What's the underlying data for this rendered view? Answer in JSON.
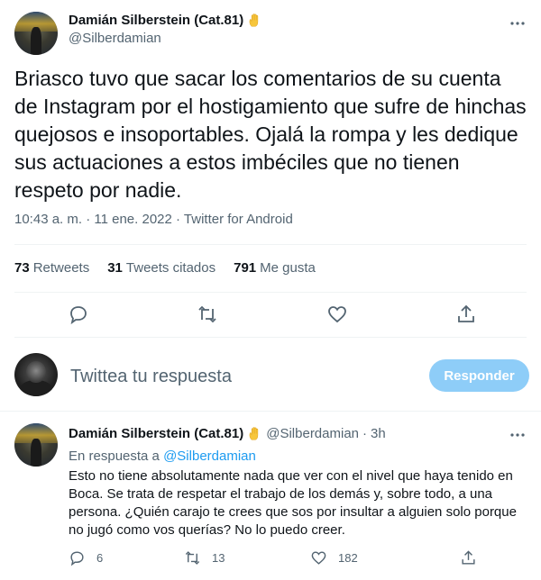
{
  "main_tweet": {
    "author_name": "Damián Silberstein (Cat.81)",
    "author_handle": "@Silberdamian",
    "text": "Briasco tuvo que sacar los comentarios de su cuenta de Instagram por el hostigamiento que sufre de hinchas quejosos e insoportables. Ojalá la rompa y les dedique sus actuaciones a estos imbéciles que no tienen respeto por nadie.",
    "meta": "10:43 a. m. · 11 ene. 2022 · Twitter for Android",
    "stats": {
      "retweets_count": "73",
      "retweets_label": "Retweets",
      "quotes_count": "31",
      "quotes_label": "Tweets citados",
      "likes_count": "791",
      "likes_label": "Me gusta"
    },
    "icons": [
      "reply-icon",
      "retweet-icon",
      "like-icon",
      "share-icon",
      "more-icon",
      "raised-hand-emoji-icon"
    ]
  },
  "reply_box": {
    "placeholder": "Twittea tu respuesta",
    "button_label": "Responder"
  },
  "reply_tweet": {
    "author_name": "Damián Silberstein (Cat.81)",
    "author_handle": "@Silberdamian",
    "separator": "·",
    "time": "3h",
    "in_reply_prefix": "En respuesta a",
    "in_reply_mention": "@Silberdamian",
    "text": "Esto no tiene absolutamente nada que ver con el nivel que haya tenido en Boca. Se trata de respetar el trabajo de los demás y, sobre todo, a una persona. ¿Quién carajo te crees que sos por insultar a alguien solo porque no jugó como vos querías? No lo puedo creer.",
    "replies_count": "6",
    "retweets_count": "13",
    "likes_count": "182"
  },
  "colors": {
    "primary_text": "#0f1419",
    "secondary_text": "#536471",
    "accent": "#1d9bf0",
    "button_disabled": "#8ecdf8",
    "divider": "#eff3f4"
  }
}
